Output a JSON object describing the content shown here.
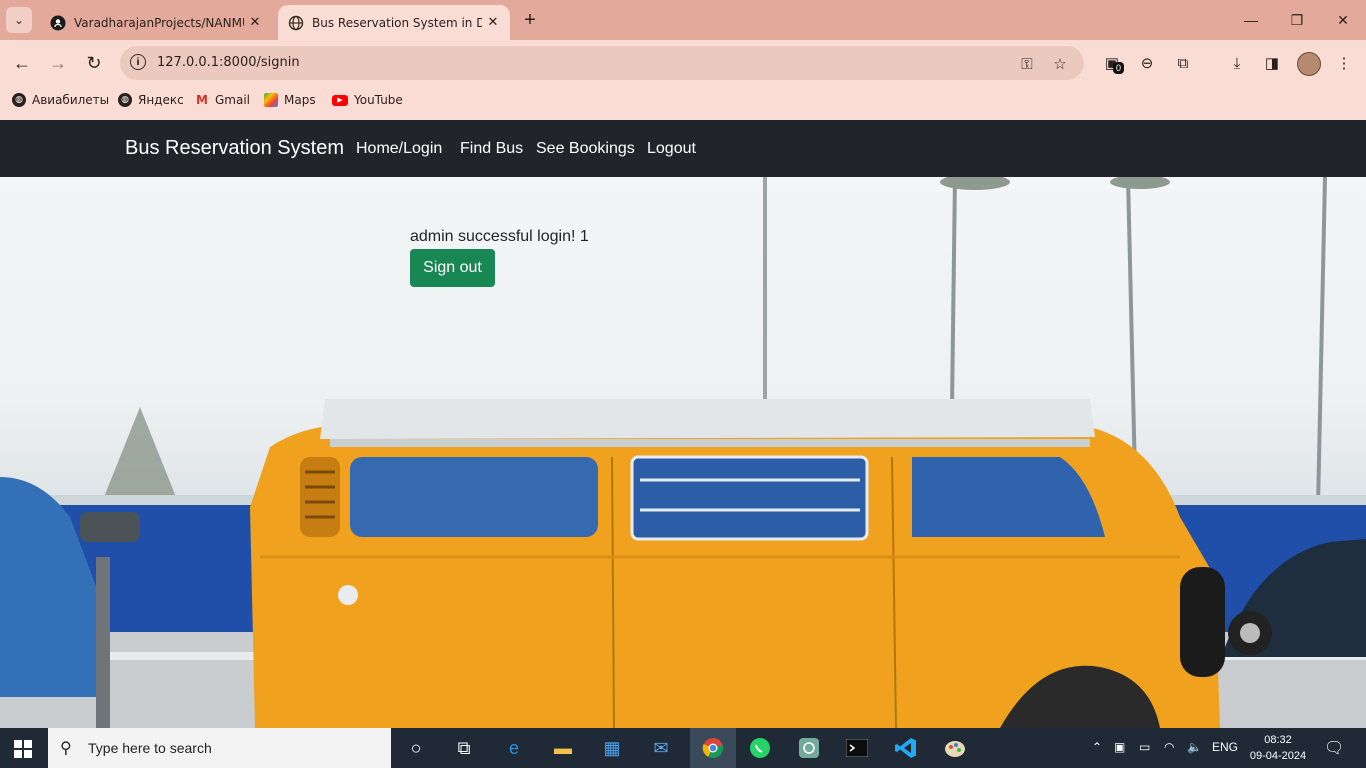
{
  "browser": {
    "tabs": [
      {
        "title": "VaradharajanProjects/NANMUD",
        "icon": "github-icon"
      },
      {
        "title": "Bus Reservation System in Djan",
        "icon": "globe-icon"
      }
    ],
    "url": "127.0.0.1:8000/signin",
    "extension_badge": "0",
    "bookmarks": [
      {
        "label": "Авиабилеты",
        "icon": "globe-icon"
      },
      {
        "label": "Яндекс",
        "icon": "globe-icon"
      },
      {
        "label": "Gmail",
        "icon": "gmail-icon"
      },
      {
        "label": "Maps",
        "icon": "maps-icon"
      },
      {
        "label": "YouTube",
        "icon": "youtube-icon"
      }
    ]
  },
  "app": {
    "brand": "Bus Reservation System",
    "nav": [
      "Home/Login",
      "Find Bus",
      "See Bookings",
      "Logout"
    ],
    "message": "admin successful login! 1",
    "signout_label": "Sign out",
    "colors": {
      "navbar": "#212529",
      "button": "#198754",
      "van": "#f0a21f"
    }
  },
  "taskbar": {
    "search_placeholder": "Type here to search",
    "language": "ENG",
    "time": "08:32",
    "date": "09-04-2024"
  }
}
